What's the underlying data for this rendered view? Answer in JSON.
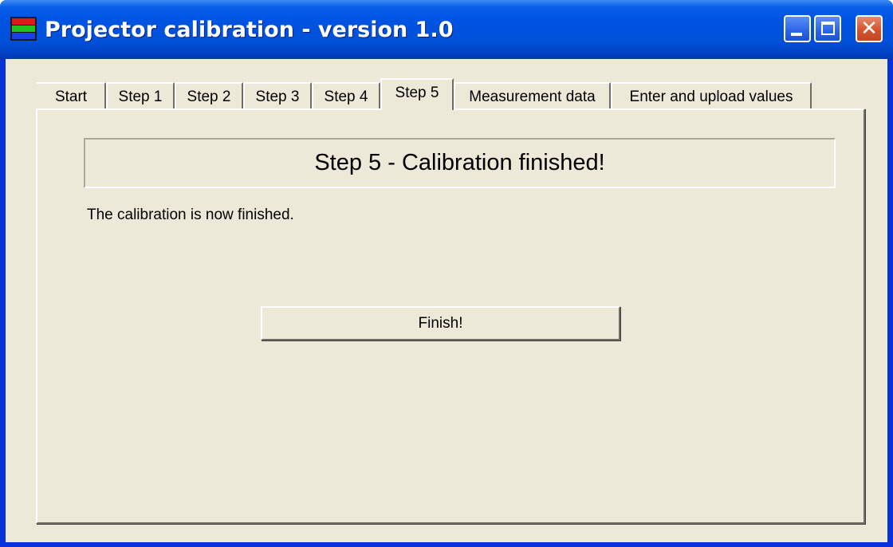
{
  "window": {
    "title": "Projector calibration - version 1.0",
    "buttons": {
      "minimize": "minimize-icon",
      "maximize": "maximize-icon",
      "close": "close-icon"
    }
  },
  "tabs": [
    {
      "label": "Start",
      "active": false
    },
    {
      "label": "Step 1",
      "active": false
    },
    {
      "label": "Step 2",
      "active": false
    },
    {
      "label": "Step 3",
      "active": false
    },
    {
      "label": "Step 4",
      "active": false
    },
    {
      "label": "Step 5",
      "active": true
    },
    {
      "label": "Measurement data",
      "active": false
    },
    {
      "label": "Enter and upload values",
      "active": false
    }
  ],
  "panel": {
    "heading": "Step 5 - Calibration finished!",
    "message": "The calibration is now finished.",
    "finish_button": "Finish!"
  },
  "colors": {
    "titlebar": "#0054e3",
    "face": "#ece9d8",
    "close_button": "#d5532d"
  }
}
